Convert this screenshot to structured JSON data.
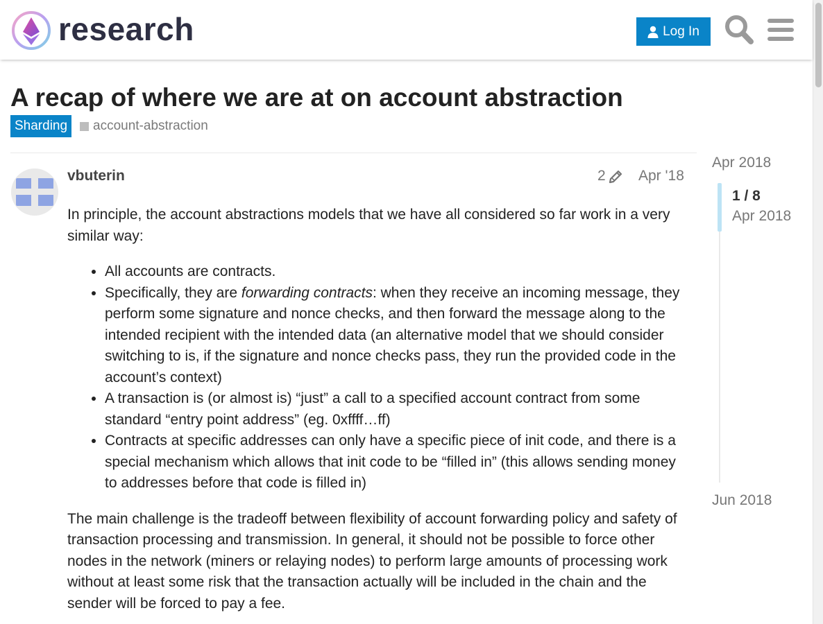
{
  "header": {
    "site_name": "research",
    "login_label": "Log In",
    "search_icon": "search-icon",
    "menu_icon": "hamburger-menu-icon",
    "accent_color": "#0a84c8"
  },
  "topic": {
    "title": "A recap of where we are at on account abstraction",
    "category": "Sharding",
    "tag": "account-abstraction"
  },
  "post": {
    "username": "vbuterin",
    "edit_count": "2",
    "date": "Apr '18",
    "intro": "In principle, the account abstractions models that we have all considered so far work in a very similar way:",
    "bullets": [
      "All accounts are contracts.",
      {
        "before": "Specifically, they are ",
        "emphasis": "forwarding contracts",
        "after": ": when they receive an incoming message, they perform some signature and nonce checks, and then forward the message along to the intended recipient with the intended data (an alternative model that we should consider switching to is, if the signature and nonce checks pass, they run the provided code in the account’s context)"
      },
      "A transaction is (or almost is) “just” a call to a specified account contract from some standard “entry point address” (eg. 0xffff…ff)",
      "Contracts at specific addresses can only have a specific piece of init code, and there is a special mechanism which allows that init code to be “filled in” (this allows sending money to addresses before that code is filled in)"
    ],
    "paragraph_2": "The main challenge is the tradeoff between flexibility of account forwarding policy and safety of transaction processing and transmission. In general, it should not be possible to force other nodes in the network (miners or relaying nodes) to perform large amounts of processing work without at least some risk that the transaction actually will be included in the chain and the sender will be forced to pay a fee."
  },
  "timeline": {
    "start_date": "Apr 2018",
    "counter": "1 / 8",
    "current_date": "Apr 2018",
    "end_date": "Jun 2018"
  }
}
